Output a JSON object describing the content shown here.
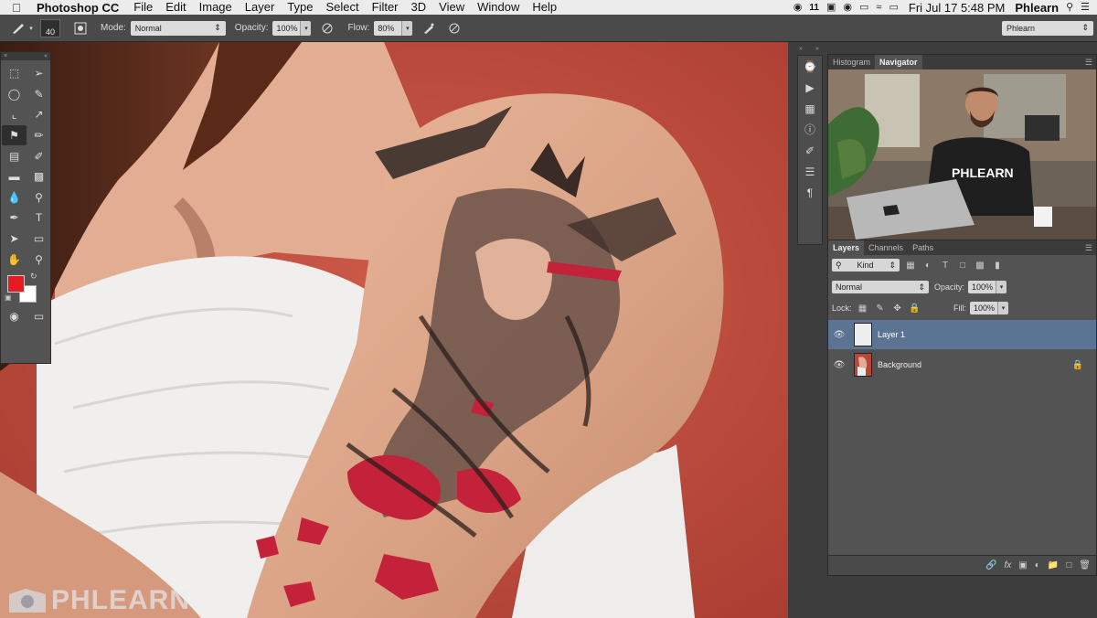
{
  "menubar": {
    "app": "Photoshop CC",
    "items": [
      "File",
      "Edit",
      "Image",
      "Layer",
      "Type",
      "Select",
      "Filter",
      "3D",
      "View",
      "Window",
      "Help"
    ],
    "badge": "11",
    "clock": "Fri Jul 17  5:48 PM",
    "user": "Phlearn"
  },
  "options": {
    "brush_size": "40",
    "mode_label": "Mode:",
    "mode_value": "Normal",
    "opacity_label": "Opacity:",
    "opacity_value": "100%",
    "flow_label": "Flow:",
    "flow_value": "80%",
    "workspace": "Phlearn"
  },
  "colors": {
    "foreground": "#e51c23",
    "background": "#ffffff"
  },
  "navigator": {
    "tabs": [
      "Histogram",
      "Navigator"
    ],
    "active_tab": "Navigator",
    "video_shirt_text": "PHLEARN"
  },
  "layers": {
    "tabs": [
      "Layers",
      "Channels",
      "Paths"
    ],
    "active_tab": "Layers",
    "filter_kind": "Kind",
    "blend_mode": "Normal",
    "opacity_label": "Opacity:",
    "opacity_value": "100%",
    "lock_label": "Lock:",
    "fill_label": "Fill:",
    "fill_value": "100%",
    "items": [
      {
        "name": "Layer 1",
        "selected": true,
        "locked": false
      },
      {
        "name": "Background",
        "selected": false,
        "locked": true
      }
    ]
  },
  "watermark": "PHLEARN"
}
